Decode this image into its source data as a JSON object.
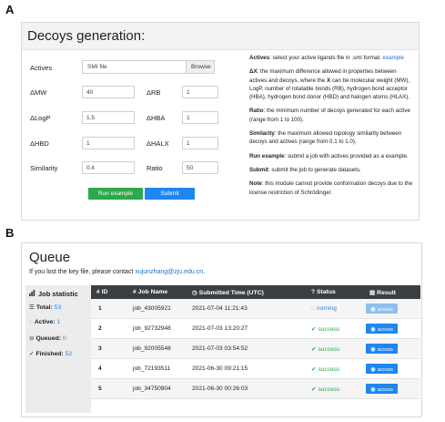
{
  "labels": {
    "a": "A",
    "b": "B"
  },
  "decoys": {
    "title": "Decoys generation:",
    "actives_label": "Actives",
    "file_placeholder": "SMI file",
    "browse": "Browse",
    "fields": {
      "dmw": {
        "label": "ΔMW",
        "value": "40"
      },
      "drb": {
        "label": "ΔRB",
        "value": "1"
      },
      "dlogp": {
        "label": "ΔLogP",
        "value": "1.5"
      },
      "dhba": {
        "label": "ΔHBA",
        "value": "1"
      },
      "dhbd": {
        "label": "ΔHBD",
        "value": "1"
      },
      "dhalx": {
        "label": "ΔHALX",
        "value": "1"
      },
      "similarity": {
        "label": "Similarity",
        "value": "0.4"
      },
      "ratio": {
        "label": "Ratio",
        "value": "50"
      }
    },
    "run_example": "Run example",
    "submit": "Submit",
    "help": {
      "actives_b": "Actives",
      "actives_t": ": select your active ligands file in .smi format.",
      "actives_link": "example",
      "dx_b": "ΔX",
      "dx_t1": ": the maximum difference allowed in properties between actives and decoys, where the ",
      "dx_x": "X",
      "dx_t2": " can be molecular weight (MW), LogP, number of rotatable bonds (RB), hydrogen bond acceptor (HBA), hydrogen bond donor (HBD) and halogen atoms (HLAX).",
      "ratio_b": "Ratio",
      "ratio_t": ": the minimum number of decoys generated for each active (range from 1 to 100).",
      "sim_b": "Similarity",
      "sim_t": ": the maximum allowed topology similarity between decoys and actives (range from 0.1 to 1.0).",
      "run_b": "Run example",
      "run_t": ": submit a job with actives provided as a example.",
      "sub_b": "Submit",
      "sub_t": ": submit the job to generate datasets.",
      "note_b": "Note",
      "note_t": ": this module cannot provide conformation decoys due to the license restriction of Schrödinger."
    }
  },
  "queue": {
    "title": "Queue",
    "contact_text": "If you lost the key file, please contact ",
    "contact_email": "xujunzhang@zju.edu.cn",
    "contact_end": ".",
    "stat": {
      "title": "Job statistic",
      "total_label": "Total:",
      "total": "53",
      "active_label": "Active:",
      "active": "1",
      "queued_label": "Queued:",
      "queued": "0",
      "finished_label": "Finished:",
      "finished": "52"
    },
    "columns": [
      "ID",
      "Job Name",
      "Submitted Time (UTC)",
      "Status",
      "Result"
    ],
    "rows": [
      {
        "id": "1",
        "name": "job_43005921",
        "time": "2021-07-04 11:21:43",
        "status": "running",
        "result": "access"
      },
      {
        "id": "2",
        "name": "job_92732948",
        "time": "2021-07-03 13:20:27",
        "status": "success",
        "result": "access"
      },
      {
        "id": "3",
        "name": "job_92005548",
        "time": "2021-07-03 03:54:52",
        "status": "success",
        "result": "access"
      },
      {
        "id": "4",
        "name": "job_72193511",
        "time": "2021-06-30 09:21:15",
        "status": "success",
        "result": "access"
      },
      {
        "id": "5",
        "name": "job_34750904",
        "time": "2021-06-30 00:26:03",
        "status": "success",
        "result": "access"
      }
    ]
  },
  "icons": {
    "bar_chart": "bar-chart-icon",
    "list": "list-icon",
    "spinner": "spinner-icon",
    "minus_circle": "minus-circle-icon",
    "check_circle": "check-circle-icon",
    "tag": "tag-icon",
    "clock": "clock-icon",
    "question_circle": "question-circle-icon",
    "file": "file-icon",
    "eye": "eye-icon"
  },
  "colors": {
    "green": "#2ea84a",
    "blue": "#1e86f0",
    "header_dark": "#3a3f44",
    "link": "#1e6fd0"
  }
}
